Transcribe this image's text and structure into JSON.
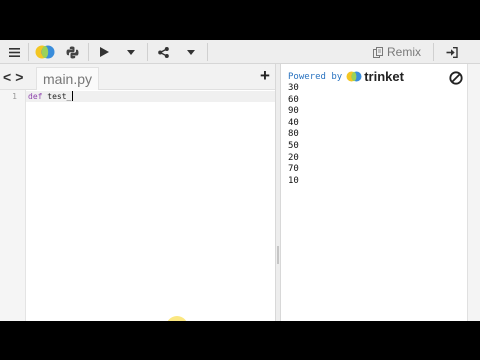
{
  "toolbar": {
    "menu_icon": "hamburger-icon",
    "trinket_icon": "trinket-logo-icon",
    "python_icon": "python-icon",
    "run_icon": "play-icon",
    "share_icon": "share-icon",
    "remix_label": "Remix",
    "remix_icon": "copy-icon",
    "login_icon": "sign-in-icon"
  },
  "editor": {
    "nav_prev": "<",
    "nav_next": ">",
    "file_tab": "main.py",
    "add_file": "+",
    "line_number": "1",
    "code_keyword": "def",
    "code_name": " test_"
  },
  "output": {
    "powered_by": "Powered by",
    "brand": "trinket",
    "lines": [
      "30",
      "60",
      "90",
      "40",
      "80",
      "50",
      "20",
      "70",
      "10"
    ]
  },
  "colors": {
    "accent_blue": "#2a73c0",
    "logo_yellow": "#f3c623",
    "logo_blue": "#3a8ddb",
    "keyword_purple": "#8e44ad"
  }
}
